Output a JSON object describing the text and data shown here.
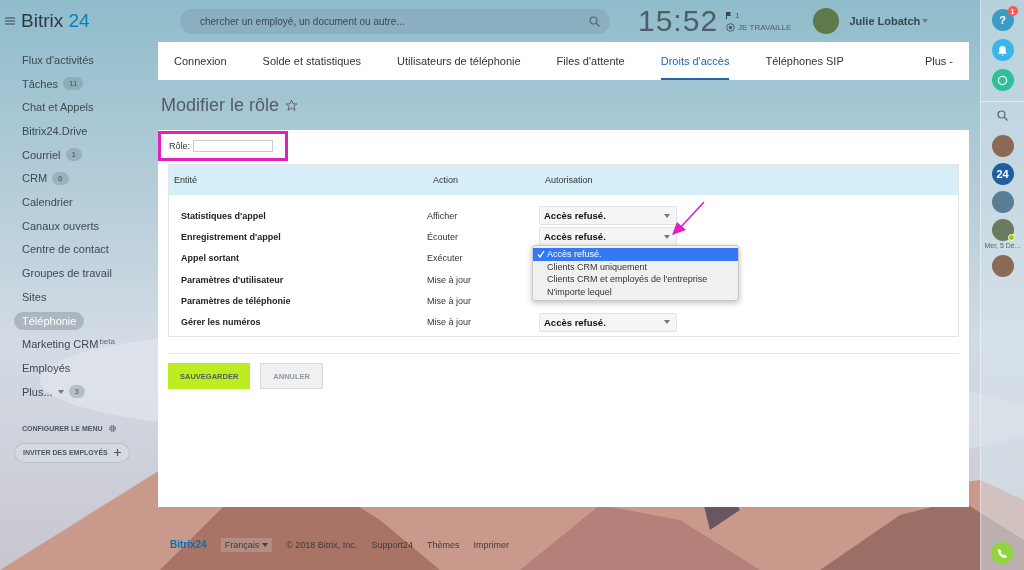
{
  "header": {
    "logo": {
      "brand": "Bitrix",
      "suffix": "24"
    },
    "search": {
      "placeholder": "chercher un employé, un document ou autre..."
    },
    "clock": "15:52",
    "flag_count": "1",
    "work_status": "JE TRAVAILLE",
    "user": {
      "name": "Julie Lobatch"
    }
  },
  "sidebar": {
    "items": [
      {
        "label": "Flux d'activités",
        "selected": false
      },
      {
        "label": "Tâches",
        "counter": "11",
        "selected": false
      },
      {
        "label": "Chat et Appels",
        "selected": false
      },
      {
        "label": "Bitrix24.Drive",
        "selected": false
      },
      {
        "label": "Courriel",
        "counter": "1",
        "selected": false
      },
      {
        "label": "CRM",
        "counter": "6",
        "selected": false
      },
      {
        "label": "Calendrier",
        "selected": false
      },
      {
        "label": "Canaux ouverts",
        "selected": false
      },
      {
        "label": "Centre de contact",
        "selected": false
      },
      {
        "label": "Groupes de travail",
        "selected": false
      },
      {
        "label": "Sites",
        "selected": false
      },
      {
        "label": "Téléphonie",
        "selected": true
      },
      {
        "label": "Marketing CRM",
        "tag": "beta",
        "selected": false
      },
      {
        "label": "Employés",
        "selected": false
      },
      {
        "label": "Plus...",
        "caret": true,
        "counter": "3",
        "selected": false
      }
    ],
    "configure": "CONFIGURER LE MENU",
    "invite": "INVITER DES EMPLOYÉS"
  },
  "tabs": [
    {
      "label": "Connexion",
      "selected": false
    },
    {
      "label": "Solde et statistiques",
      "selected": false
    },
    {
      "label": "Utilisateurs de téléphonie",
      "selected": false
    },
    {
      "label": "Files d'attente",
      "selected": false
    },
    {
      "label": "Droits d'accès",
      "selected": true
    },
    {
      "label": "Téléphones SIP",
      "selected": false
    },
    {
      "label": "Plus -",
      "selected": false
    }
  ],
  "page_title": "Modifier le rôle",
  "form": {
    "role_label": "Rôle:",
    "highlighted": true,
    "table": {
      "columns": [
        "Entité",
        "Action",
        "Autorisation"
      ],
      "rows": [
        {
          "entity": "Statistiques d'appel",
          "action": "Afficher",
          "permission": "Accès refusé."
        },
        {
          "entity": "Enregistrement d'appel",
          "action": "Écouter",
          "permission": "Accès refusé."
        },
        {
          "entity": "Appel sortant",
          "action": "Exécuter"
        },
        {
          "entity": "Paramètres d'utilisateur",
          "action": "Mise à jour"
        },
        {
          "entity": "Paramètres de téléphonie",
          "action": "Mise à jour"
        },
        {
          "entity": "Gérer les numéros",
          "action": "Mise à jour",
          "permission": "Accès refusé."
        }
      ]
    },
    "dropdown": {
      "options": [
        {
          "label": "Accès refusé.",
          "selected": true
        },
        {
          "label": "Clients CRM uniquement",
          "selected": false
        },
        {
          "label": "Clients CRM et employés de l'entreprise",
          "selected": false
        },
        {
          "label": "N'importe lequel",
          "selected": false
        }
      ]
    },
    "buttons": [
      {
        "label": "SAUVEGARDER",
        "kind": "primary"
      },
      {
        "label": "ANNULER",
        "kind": "secondary"
      }
    ]
  },
  "right_rail": {
    "help_label": "?",
    "help_badge": "1",
    "contacts": [
      {
        "kind": "avatar",
        "online": false
      },
      {
        "kind": "logo",
        "label": "24"
      },
      {
        "kind": "avatar",
        "online": false
      },
      {
        "kind": "avatar",
        "online": true,
        "caption": "Mer, 5 Dé..."
      },
      {
        "kind": "avatar",
        "online": false
      }
    ]
  },
  "footer": {
    "logo": "Bitrix24",
    "language": "Français",
    "copyright": "© 2018 Bitrix, Inc.",
    "links": [
      "Support24",
      "Thèmes",
      "Imprimer"
    ]
  }
}
